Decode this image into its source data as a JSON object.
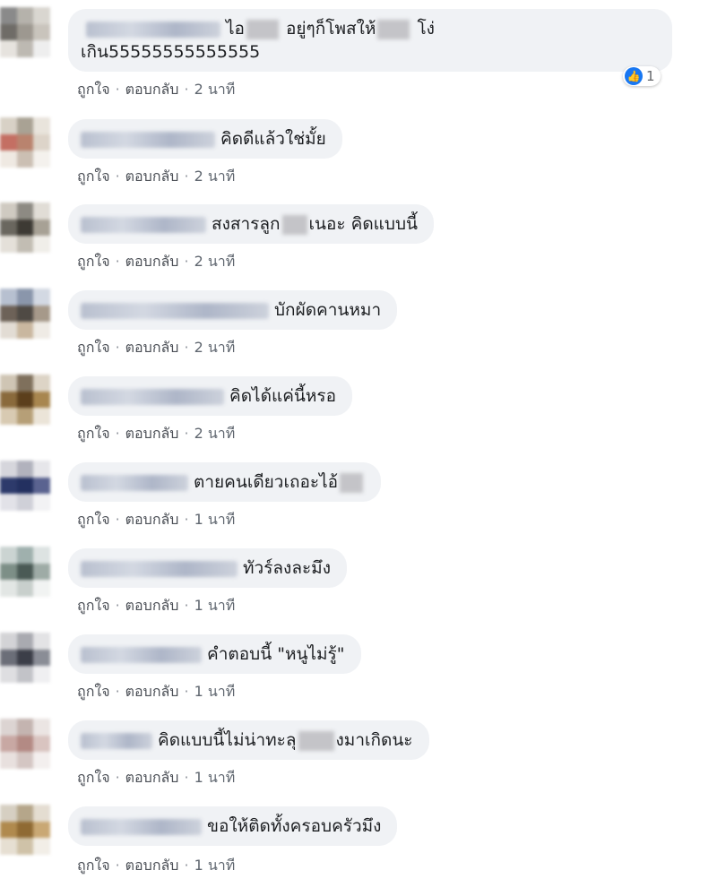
{
  "colors": {
    "bubble": "#f0f2f5",
    "like_blue": "#1877f2",
    "action_text": "#606770"
  },
  "actions": {
    "like": "ถูกใจ",
    "reply": "ตอบกลับ",
    "separator": "·"
  },
  "comments": [
    {
      "text_before": "ไอ",
      "text_mid": "อยู่ๆก็โพสให้",
      "text_after": "โง่",
      "text_line2": "เกิน55555555555555",
      "time": "2 นาที",
      "reaction_count": "1"
    },
    {
      "text": "คิดดีแล้วใช่มั้ย",
      "time": "2 นาที"
    },
    {
      "text_before": "สงสารลูก",
      "text_after": "เนอะ คิดแบบนี้",
      "time": "2 นาที"
    },
    {
      "text": "บักผัดคานหมา",
      "time": "2 นาที"
    },
    {
      "text": "คิดได้แค่นี้หรอ",
      "time": "2 นาที"
    },
    {
      "text": "ตายคนเดียวเถอะไอ้",
      "time": "1 นาที"
    },
    {
      "text": "ทัวร์ลงละมึง",
      "time": "1 นาที"
    },
    {
      "text": "คำตอบนี้ \"หนูไม่รู้\"",
      "time": "1 นาที"
    },
    {
      "text_before": "คิดแบบนี้ไม่น่าทะลุ",
      "text_after": "งมาเกิดนะ",
      "time": "1 นาที"
    },
    {
      "text": "ขอให้ติดทั้งครอบครัวมึง",
      "time": "1 นาที"
    }
  ]
}
